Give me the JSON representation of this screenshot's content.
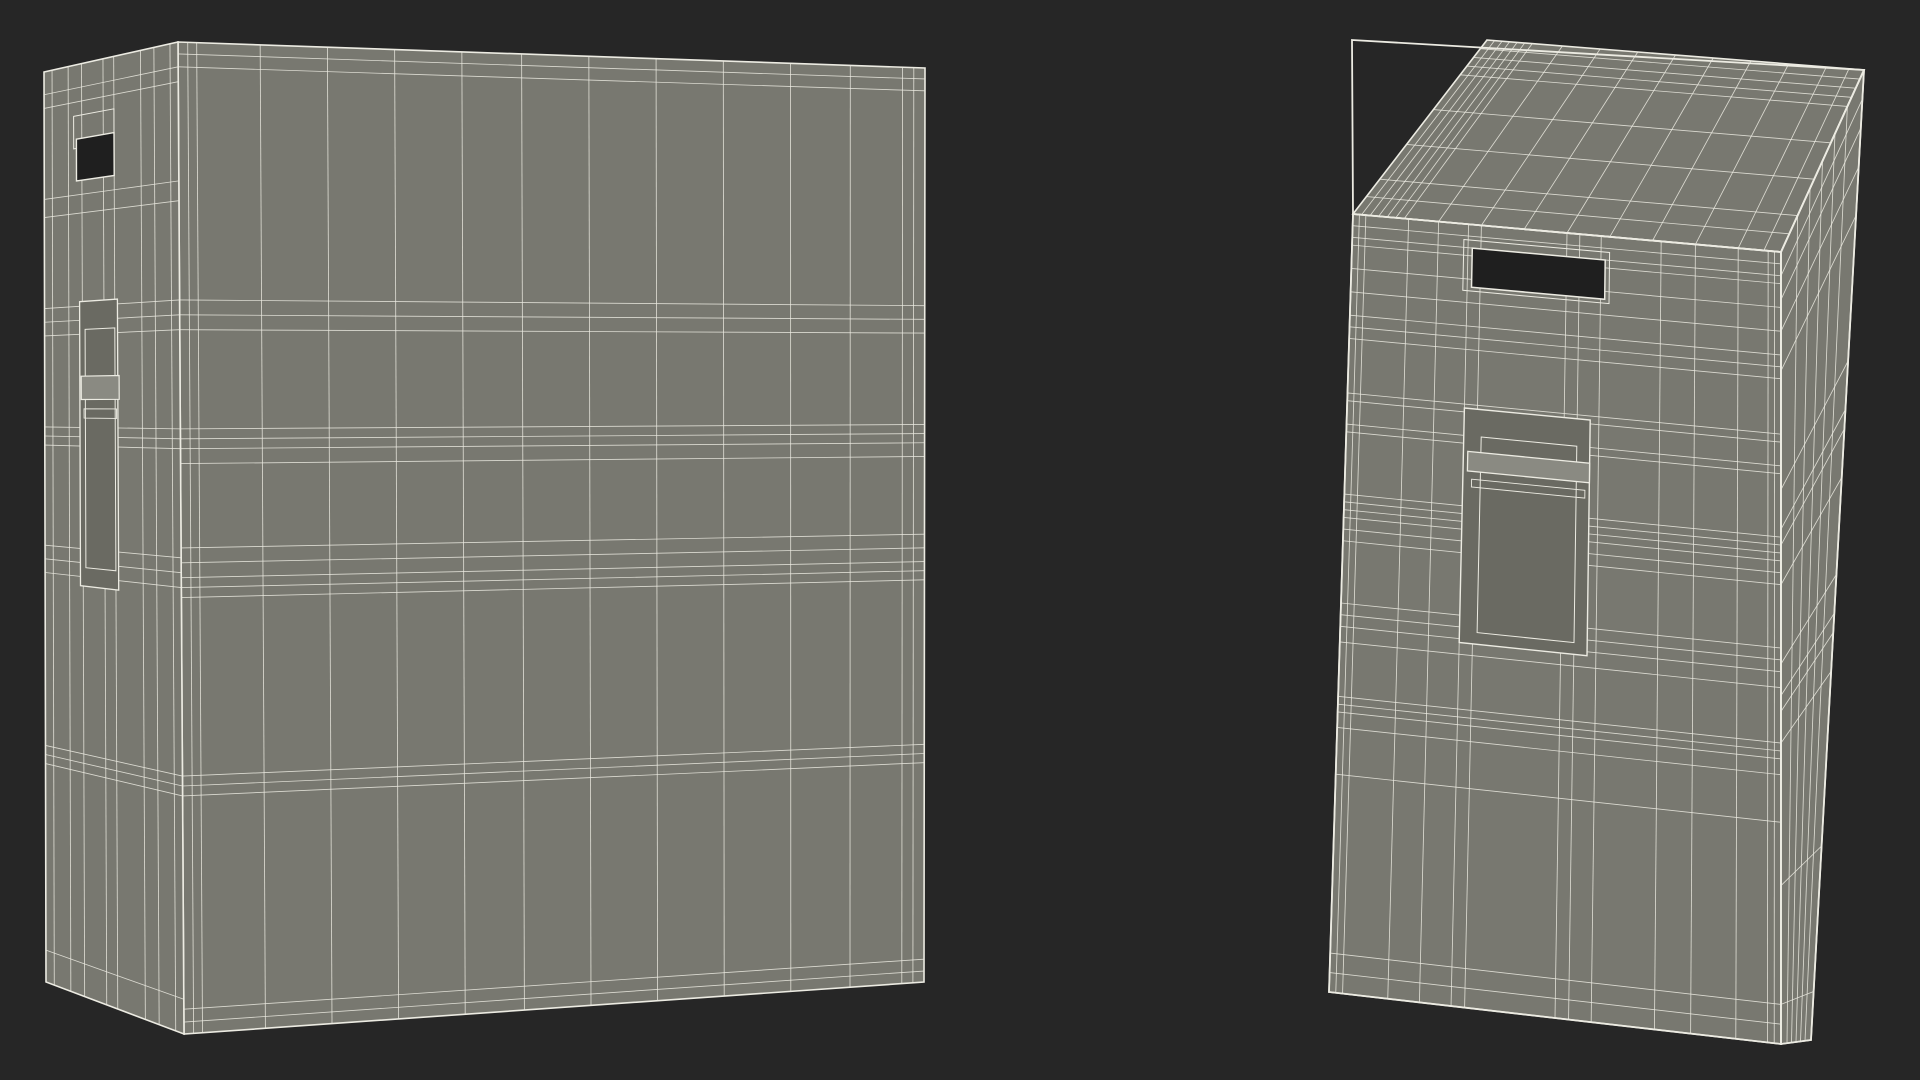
{
  "scene": {
    "background_color": "#262626",
    "surface_color": "#787870",
    "wire_color": "#ecebe2",
    "hole_color": "#1f1f1f",
    "objects": [
      {
        "name": "box-front-view",
        "faces": [
          "front-face",
          "left-side-face"
        ],
        "features": [
          "handle-cutout",
          "strap-buckle"
        ]
      },
      {
        "name": "box-angled-view",
        "faces": [
          "top-face",
          "front-face",
          "right-side-face"
        ],
        "features": [
          "handle-cutout",
          "strap-buckle"
        ]
      }
    ]
  }
}
